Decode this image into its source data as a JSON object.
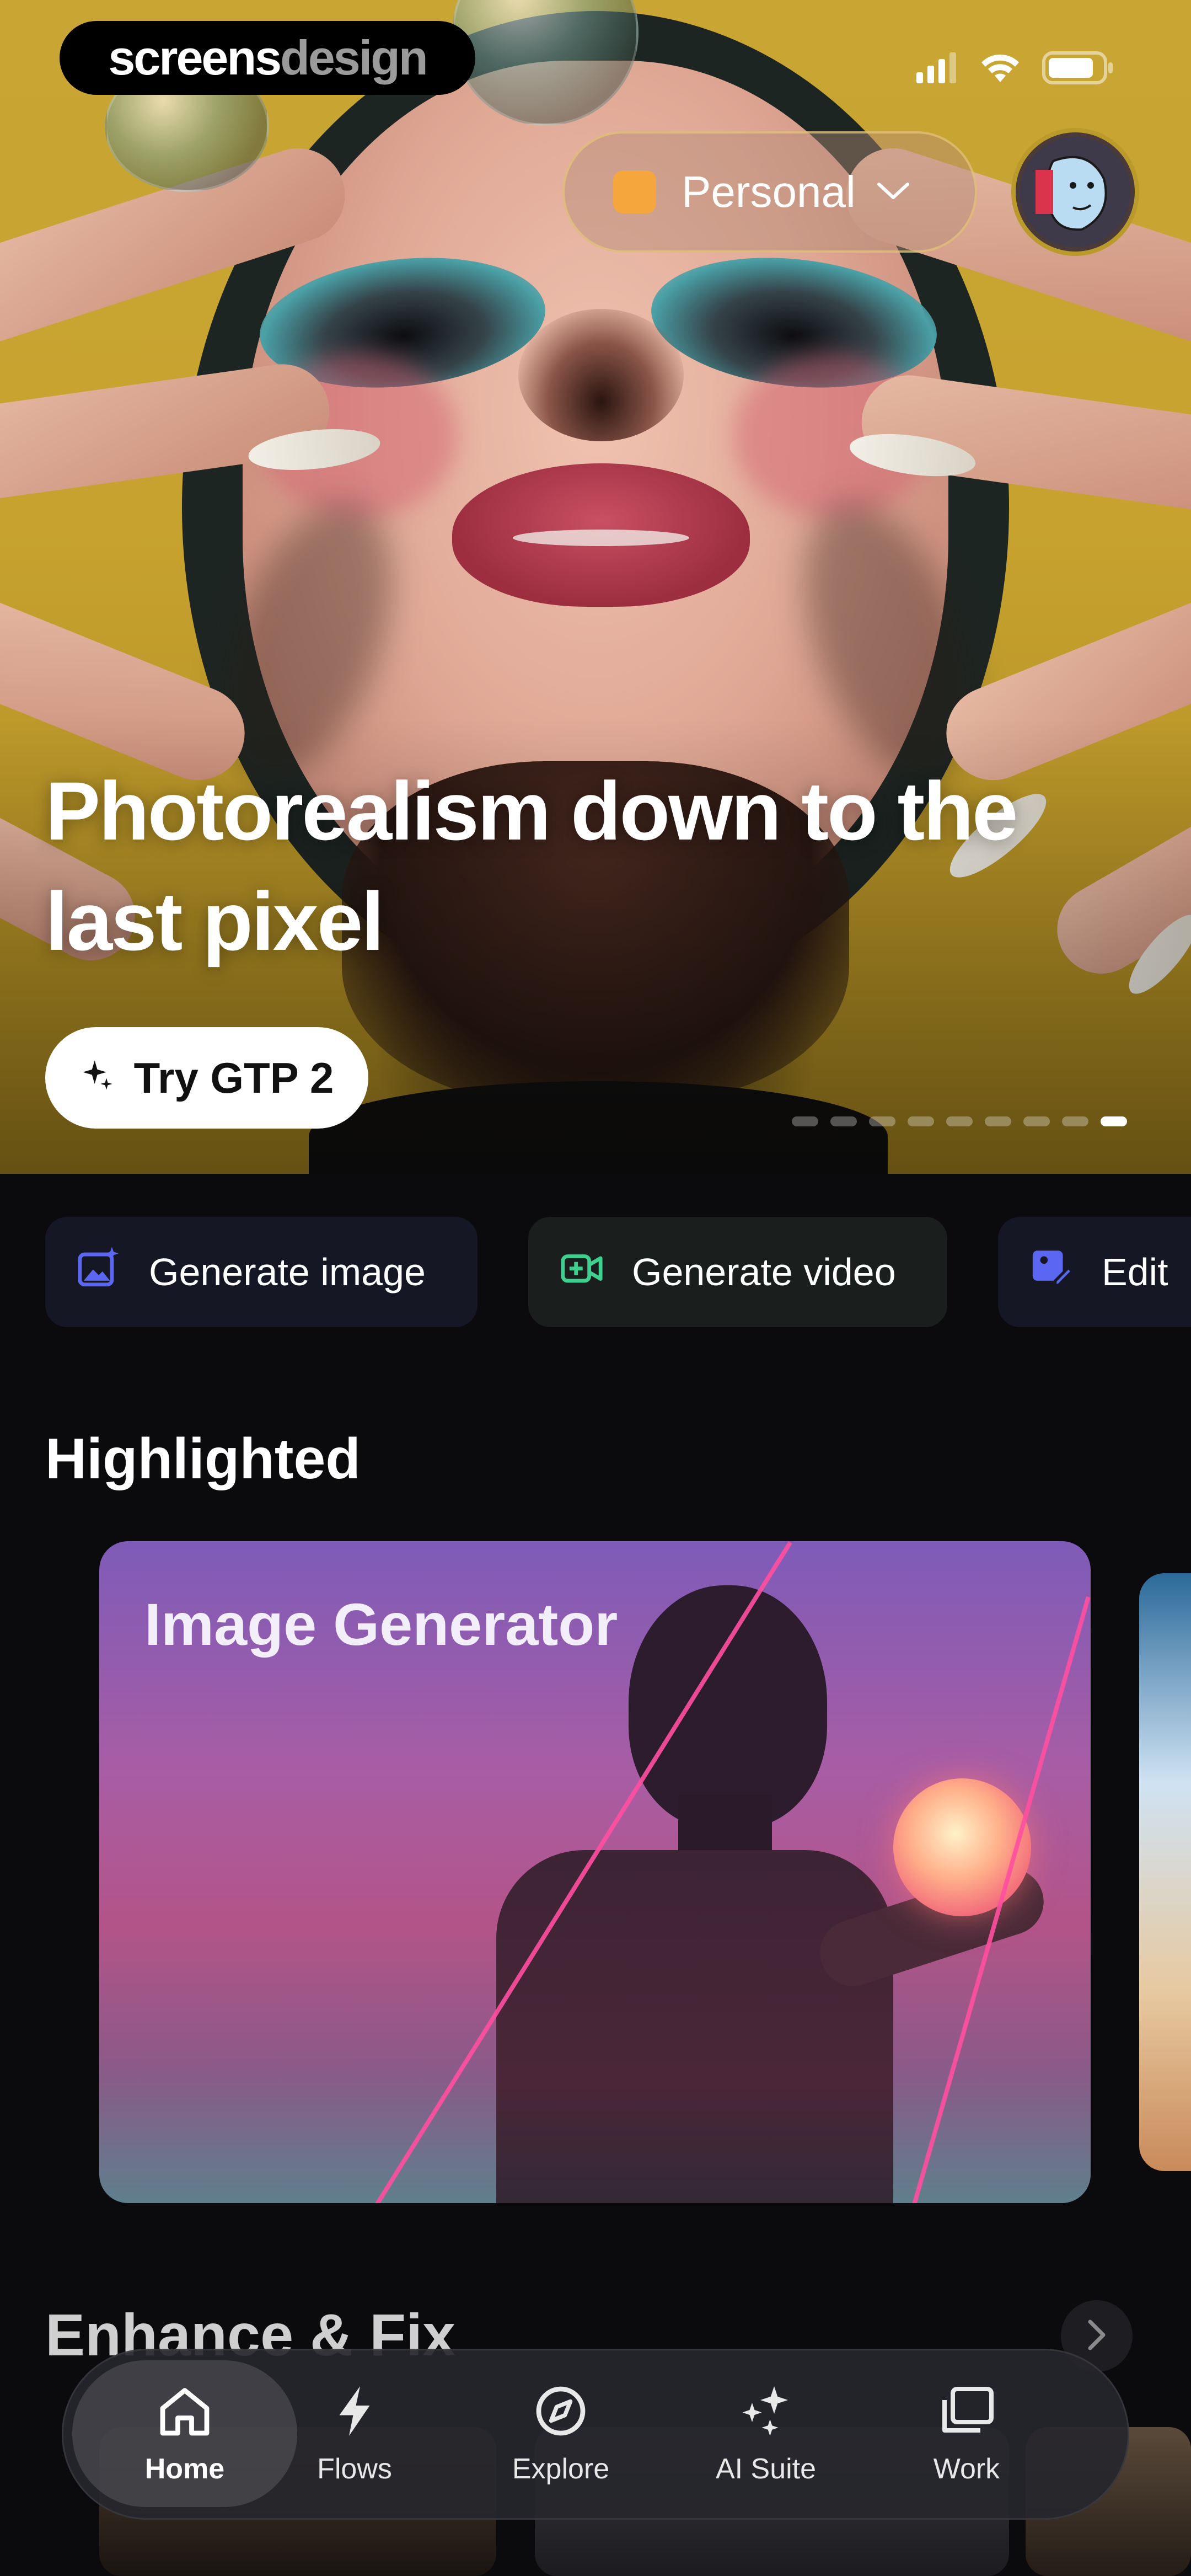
{
  "brand": {
    "part1": "screens",
    "part2": "design"
  },
  "header": {
    "workspace_label": "Personal",
    "workspace_color": "#f5a63d"
  },
  "hero": {
    "title": "Photorealism down to the last pixel",
    "cta_label": "Try GTP 2",
    "carousel": {
      "count": 9,
      "active_index": 8
    }
  },
  "actions": [
    {
      "label": "Generate image",
      "icon": "image-sparkle-icon",
      "accent": "#5b67f2"
    },
    {
      "label": "Generate video",
      "icon": "video-camera-icon",
      "accent": "#3fcf8e"
    },
    {
      "label": "Edit",
      "icon": "edit-image-icon",
      "accent": "#5b67f2"
    }
  ],
  "sections": {
    "highlighted": "Highlighted",
    "enhance": "Enhance & Fix"
  },
  "highlighted_card": {
    "title": "Image Generator"
  },
  "tabbar": {
    "items": [
      {
        "label": "Home",
        "icon": "home-icon",
        "active": true
      },
      {
        "label": "Flows",
        "icon": "lightning-icon",
        "active": false
      },
      {
        "label": "Explore",
        "icon": "compass-icon",
        "active": false
      },
      {
        "label": "AI Suite",
        "icon": "sparkles-icon",
        "active": false
      },
      {
        "label": "Work",
        "icon": "stacked-images-icon",
        "active": false
      }
    ]
  }
}
